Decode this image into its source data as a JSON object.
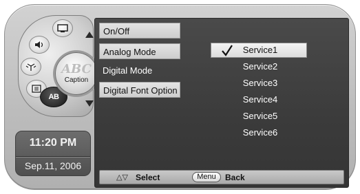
{
  "dial": {
    "center_label": "Caption",
    "center_watermark": "ABC",
    "ab_label": "AB",
    "icons": [
      "screen-icon",
      "speaker-icon",
      "antenna-icon",
      "settings-icon"
    ]
  },
  "clock": {
    "time": "11:20 PM",
    "date": "Sep.11, 2006"
  },
  "menu": {
    "items": [
      {
        "label": "On/Off",
        "highlighted": true
      },
      {
        "label": "Analog Mode",
        "highlighted": true
      },
      {
        "label": "Digital Mode",
        "highlighted": false
      },
      {
        "label": "Digital Font Option",
        "highlighted": true
      }
    ]
  },
  "services": {
    "selected_index": 0,
    "items": [
      "Service1",
      "Service2",
      "Service3",
      "Service4",
      "Service5",
      "Service6"
    ]
  },
  "help": {
    "select_arrows": "△▽",
    "select_label": "Select",
    "menu_button": "Menu",
    "back_label": "Back"
  },
  "colors": {
    "panel": "#3b3b3b",
    "highlight": "#d9d9d9",
    "frame": "#c3c3c3"
  }
}
